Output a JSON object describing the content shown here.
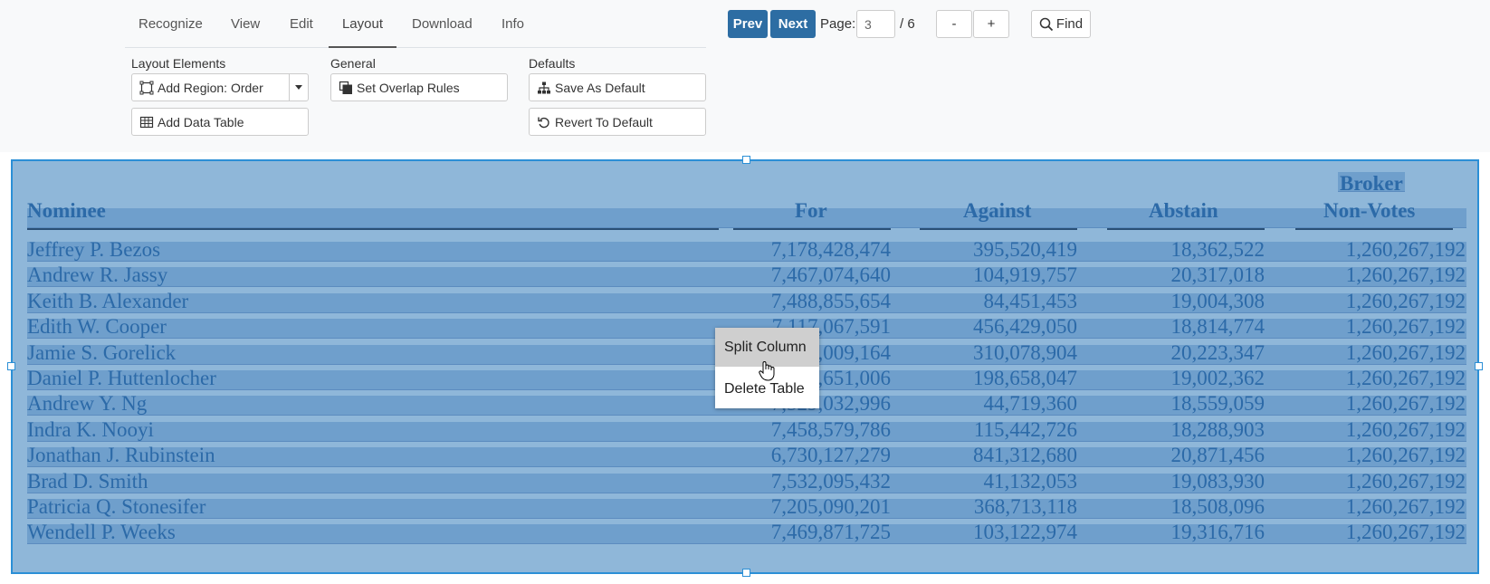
{
  "tabs": [
    {
      "label": "Recognize"
    },
    {
      "label": "View"
    },
    {
      "label": "Edit"
    },
    {
      "label": "Layout"
    },
    {
      "label": "Download"
    },
    {
      "label": "Info"
    }
  ],
  "layout_panel": {
    "layout_elements_label": "Layout Elements",
    "general_label": "General",
    "defaults_label": "Defaults",
    "add_region_label": "Add Region: Order",
    "add_data_table_label": "Add Data Table",
    "set_overlap_label": "Set Overlap Rules",
    "save_default_label": "Save As Default",
    "revert_default_label": "Revert To Default"
  },
  "pager": {
    "prev_label": "Prev",
    "next_label": "Next",
    "page_label": "Page:",
    "current_page": "3",
    "total_label": "/ 6",
    "zoom_out_label": "-",
    "zoom_in_label": "+",
    "find_label": "Find"
  },
  "table": {
    "headers": {
      "nominee": "Nominee",
      "for": "For",
      "against": "Against",
      "abstain": "Abstain",
      "broker_line1": "Broker",
      "broker_line2": "Non-Votes"
    },
    "rows": [
      {
        "name": "Jeffrey P. Bezos",
        "for": "7,178,428,474",
        "against": "395,520,419",
        "abstain": "18,362,522",
        "broker": "1,260,267,192"
      },
      {
        "name": "Andrew R. Jassy",
        "for": "7,467,074,640",
        "against": "104,919,757",
        "abstain": "20,317,018",
        "broker": "1,260,267,192"
      },
      {
        "name": "Keith B. Alexander",
        "for": "7,488,855,654",
        "against": "84,451,453",
        "abstain": "19,004,308",
        "broker": "1,260,267,192"
      },
      {
        "name": "Edith W. Cooper",
        "for": "7,117,067,591",
        "against": "456,429,050",
        "abstain": "18,814,774",
        "broker": "1,260,267,192"
      },
      {
        "name": "Jamie S. Gorelick",
        "for": "7,262,009,164",
        "against": "310,078,904",
        "abstain": "20,223,347",
        "broker": "1,260,267,192"
      },
      {
        "name": "Daniel P. Huttenlocher",
        "for": "7,374,651,006",
        "against": "198,658,047",
        "abstain": "19,002,362",
        "broker": "1,260,267,192"
      },
      {
        "name": "Andrew Y. Ng",
        "for": "7,529,032,996",
        "against": "44,719,360",
        "abstain": "18,559,059",
        "broker": "1,260,267,192"
      },
      {
        "name": "Indra K. Nooyi",
        "for": "7,458,579,786",
        "against": "115,442,726",
        "abstain": "18,288,903",
        "broker": "1,260,267,192"
      },
      {
        "name": "Jonathan J. Rubinstein",
        "for": "6,730,127,279",
        "against": "841,312,680",
        "abstain": "20,871,456",
        "broker": "1,260,267,192"
      },
      {
        "name": "Brad D. Smith",
        "for": "7,532,095,432",
        "against": "41,132,053",
        "abstain": "19,083,930",
        "broker": "1,260,267,192"
      },
      {
        "name": "Patricia Q. Stonesifer",
        "for": "7,205,090,201",
        "against": "368,713,118",
        "abstain": "18,508,096",
        "broker": "1,260,267,192"
      },
      {
        "name": "Wendell P. Weeks",
        "for": "7,469,871,725",
        "against": "103,122,974",
        "abstain": "19,316,716",
        "broker": "1,260,267,192"
      }
    ]
  },
  "context_menu": {
    "split_column_label": "Split Column",
    "delete_table_label": "Delete Table"
  },
  "colors": {
    "accent": "#2d6da3",
    "selection_border": "#2b8fd6",
    "table_text": "#2c6aa8"
  }
}
